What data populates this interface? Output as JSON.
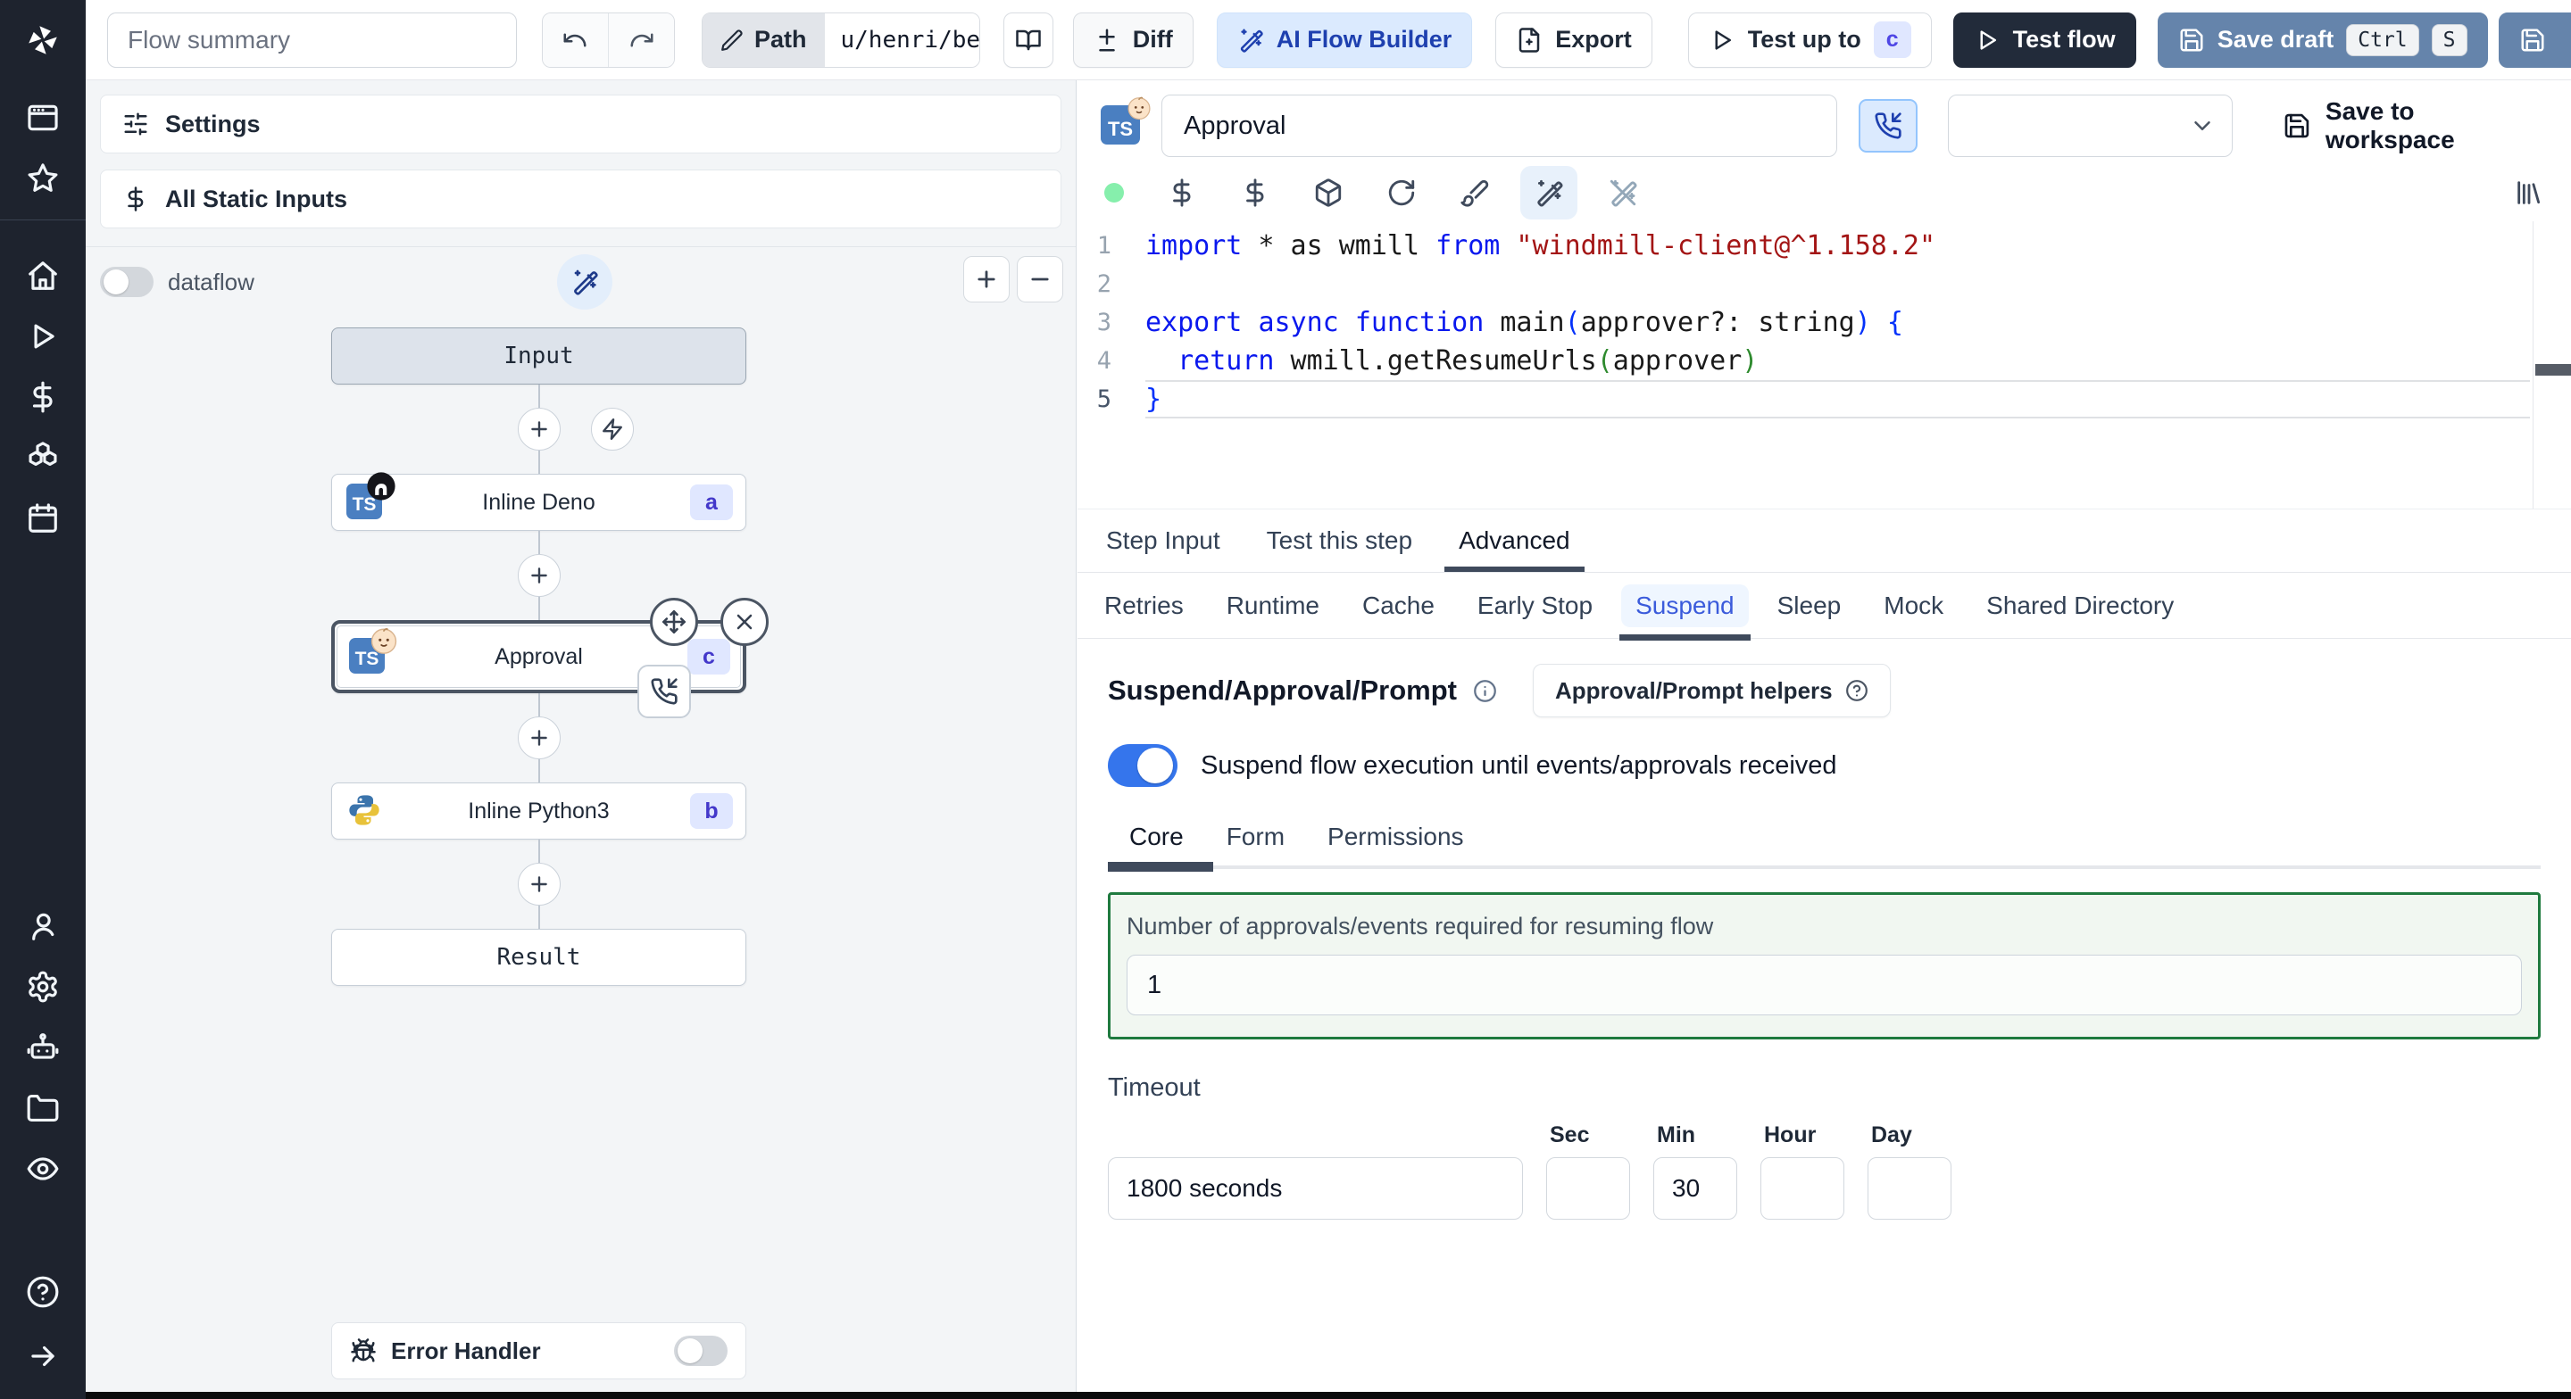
{
  "sidebar": {
    "icons": [
      "windmill-logo",
      "app-window",
      "star",
      "home",
      "play",
      "dollar",
      "boxes",
      "calendar",
      "user",
      "settings-gear",
      "bot",
      "folder",
      "eye",
      "help",
      "arrow-right"
    ]
  },
  "topbar": {
    "flow_summary_placeholder": "Flow summary",
    "path_label": "Path",
    "path_value": "u/henri/bes",
    "diff_label": "Diff",
    "ai_flow_builder_label": "AI Flow Builder",
    "export_label": "Export",
    "test_up_to_label": "Test up to",
    "test_up_to_badge": "c",
    "test_flow_label": "Test flow",
    "save_draft_label": "Save draft",
    "shortcut_ctrl": "Ctrl",
    "shortcut_s": "S"
  },
  "left_panel": {
    "settings_label": "Settings",
    "all_static_inputs_label": "All Static Inputs",
    "dataflow_label": "dataflow",
    "graph": {
      "input_label": "Input",
      "steps": [
        {
          "label": "Inline Deno",
          "badge": "a"
        },
        {
          "label": "Approval",
          "badge": "c"
        },
        {
          "label": "Inline Python3",
          "badge": "b"
        }
      ],
      "result_label": "Result"
    },
    "error_handler_label": "Error Handler"
  },
  "editor": {
    "step_name": "Approval",
    "save_to_workspace_label": "Save to workspace",
    "code": {
      "current_line": 5,
      "lines": [
        {
          "n": "1",
          "tokens": [
            {
              "c": "kw",
              "t": "import"
            },
            {
              "c": "pl",
              "t": " * as wmill "
            },
            {
              "c": "kw",
              "t": "from"
            },
            {
              "c": "str",
              "t": " \"windmill-client@^1.158.2\""
            }
          ]
        },
        {
          "n": "2",
          "tokens": []
        },
        {
          "n": "3",
          "tokens": [
            {
              "c": "kw",
              "t": "export"
            },
            {
              "c": "pl",
              "t": " "
            },
            {
              "c": "kw",
              "t": "async"
            },
            {
              "c": "pl",
              "t": " "
            },
            {
              "c": "kw",
              "t": "function"
            },
            {
              "c": "pl",
              "t": " main"
            },
            {
              "c": "p1",
              "t": "("
            },
            {
              "c": "pl",
              "t": "approver?: string"
            },
            {
              "c": "p1",
              "t": ")"
            },
            {
              "c": "pl",
              "t": " "
            },
            {
              "c": "p1",
              "t": "{"
            }
          ]
        },
        {
          "n": "4",
          "tokens": [
            {
              "c": "pl",
              "t": "  "
            },
            {
              "c": "kw",
              "t": "return"
            },
            {
              "c": "pl",
              "t": " wmill.getResumeUrls"
            },
            {
              "c": "p2",
              "t": "("
            },
            {
              "c": "pl",
              "t": "approver"
            },
            {
              "c": "p2",
              "t": ")"
            }
          ]
        },
        {
          "n": "5",
          "tokens": [
            {
              "c": "p1",
              "t": "}"
            }
          ]
        }
      ]
    }
  },
  "tabs": {
    "main": [
      "Step Input",
      "Test this step",
      "Advanced"
    ],
    "main_active": "Advanced",
    "sub": [
      "Retries",
      "Runtime",
      "Cache",
      "Early Stop",
      "Suspend",
      "Sleep",
      "Mock",
      "Shared Directory"
    ],
    "sub_active": "Suspend"
  },
  "suspend": {
    "heading": "Suspend/Approval/Prompt",
    "helpers_button_label": "Approval/Prompt helpers",
    "toggle_label": "Suspend flow execution until events/approvals received",
    "inner_tabs": [
      "Core",
      "Form",
      "Permissions"
    ],
    "inner_active": "Core",
    "approvals_label": "Number of approvals/events required for resuming flow",
    "approvals_value": "1",
    "timeout_label": "Timeout",
    "timeout_value": "1800 seconds",
    "units": {
      "sec_label": "Sec",
      "sec_value": "",
      "min_label": "Min",
      "min_value": "30",
      "hour_label": "Hour",
      "hour_value": "",
      "day_label": "Day",
      "day_value": ""
    }
  },
  "colors": {
    "accent_blue": "#3575ec",
    "badge_bg": "#e0e7ff",
    "badge_text": "#4338ca",
    "selected_node_border": "#4b5563",
    "approvals_box_border": "#1f7a3f",
    "test_flow_button": "#222b3a",
    "save_draft_button": "#6584ab",
    "status_dot": "#86efac"
  }
}
